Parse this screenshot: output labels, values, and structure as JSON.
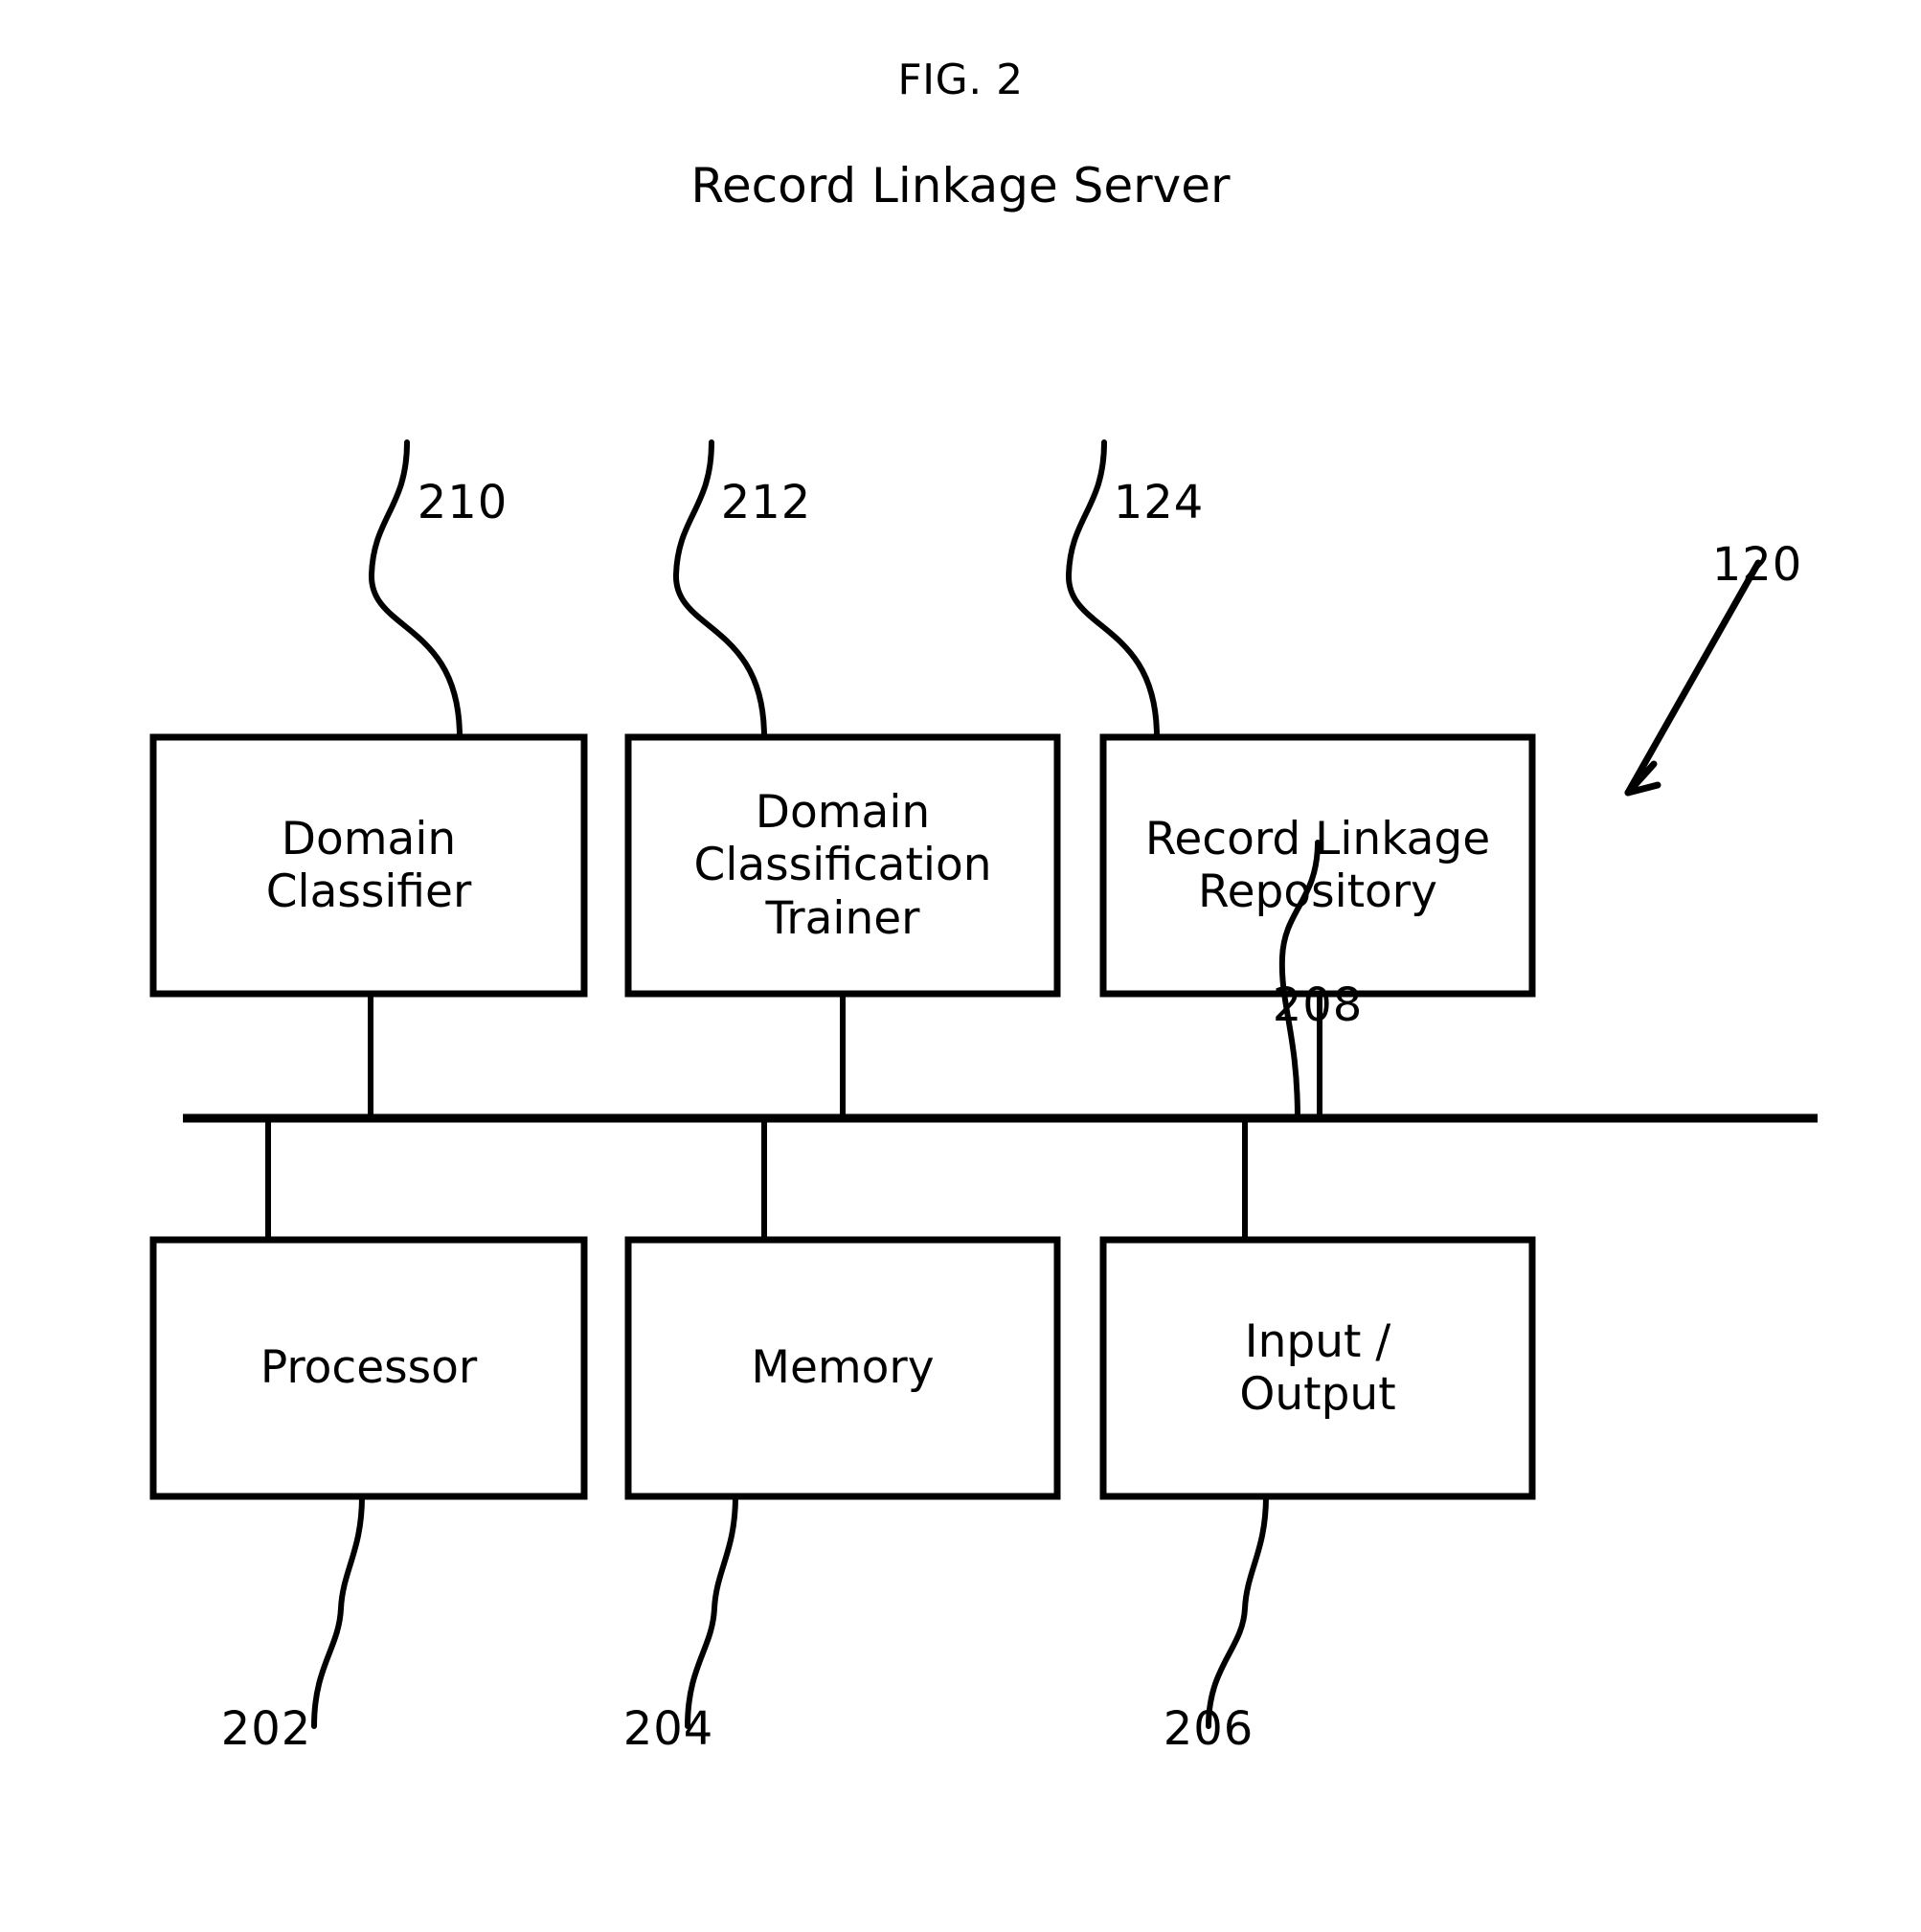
{
  "figure": {
    "title": "FIG. 2",
    "subtitle": "Record Linkage Server"
  },
  "diagram": {
    "type": "block-diagram",
    "system_ref": "120",
    "bus_ref": "208",
    "top_row": [
      {
        "id": "domain-classifier",
        "ref": "210",
        "lines": [
          "Domain",
          "Classifier"
        ]
      },
      {
        "id": "domain-classification-trainer",
        "ref": "212",
        "lines": [
          "Domain",
          "Classification",
          "Trainer"
        ]
      },
      {
        "id": "record-linkage-repository",
        "ref": "124",
        "lines": [
          "Record Linkage",
          "Repository"
        ]
      }
    ],
    "bottom_row": [
      {
        "id": "processor",
        "ref": "202",
        "lines": [
          "Processor"
        ]
      },
      {
        "id": "memory",
        "ref": "204",
        "lines": [
          "Memory"
        ]
      },
      {
        "id": "input-output",
        "ref": "206",
        "lines": [
          "Input /",
          "Output"
        ]
      }
    ],
    "colors": {
      "stroke": "#000000",
      "background": "#ffffff"
    }
  }
}
